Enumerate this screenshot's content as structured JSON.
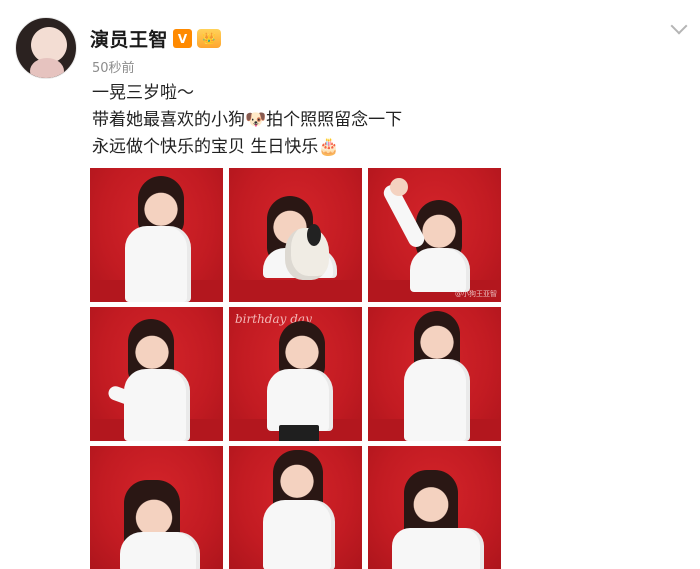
{
  "post": {
    "username": "演员王智",
    "vip_badge": "V",
    "timestamp": "50秒前",
    "text_lines": [
      "一晃三岁啦～",
      "带着她最喜欢的小狗🐶拍个照照留念一下",
      "永远做个快乐的宝贝 生日快乐🎂"
    ],
    "photos": [
      {
        "name": "photo-1",
        "watermark": ""
      },
      {
        "name": "photo-2",
        "watermark": ""
      },
      {
        "name": "photo-3",
        "watermark": "@小狗王亚智"
      },
      {
        "name": "photo-4",
        "watermark": ""
      },
      {
        "name": "photo-5",
        "scribble": "birthday day"
      },
      {
        "name": "photo-6",
        "watermark": ""
      },
      {
        "name": "photo-7",
        "watermark": ""
      },
      {
        "name": "photo-8",
        "watermark": ""
      },
      {
        "name": "photo-9",
        "watermark": ""
      }
    ]
  },
  "colors": {
    "background_red": "#c21b22",
    "vip_orange": "#ff8a00",
    "timestamp_gray": "#8c8c8c"
  }
}
